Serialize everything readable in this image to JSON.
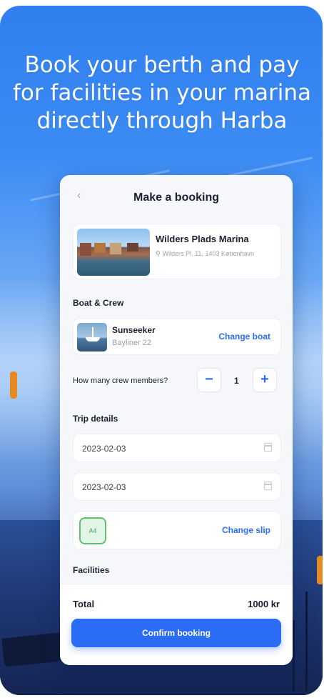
{
  "promo": {
    "headline_lines": [
      "Book your berth and pay",
      "for facilities in your marina",
      "directly through Harba"
    ]
  },
  "screen": {
    "back_icon": "chevron-left-icon",
    "title": "Make a booking",
    "marina": {
      "name": "Wilders Plads Marina",
      "address": "Wilders Pl. 11, 1403 København"
    },
    "boat_section_label": "Boat & Crew",
    "boat": {
      "name": "Sunseeker",
      "model": "Bayliner 22",
      "change_label": "Change boat"
    },
    "crew": {
      "question": "How many crew members?",
      "value": "1",
      "decrement": "−",
      "increment": "+"
    },
    "trip_section_label": "Trip details",
    "trip": {
      "start_date": "2023-02-03",
      "end_date": "2023-02-03"
    },
    "slip": {
      "code": "A4",
      "change_label": "Change slip"
    },
    "facilities_label": "Facilities",
    "total": {
      "label": "Total",
      "value": "1000 kr"
    },
    "confirm_label": "Confirm booking"
  },
  "colors": {
    "accent": "#2a6df4",
    "slip_badge_border": "#5cc26f",
    "background_top": "#2f7ff0"
  }
}
